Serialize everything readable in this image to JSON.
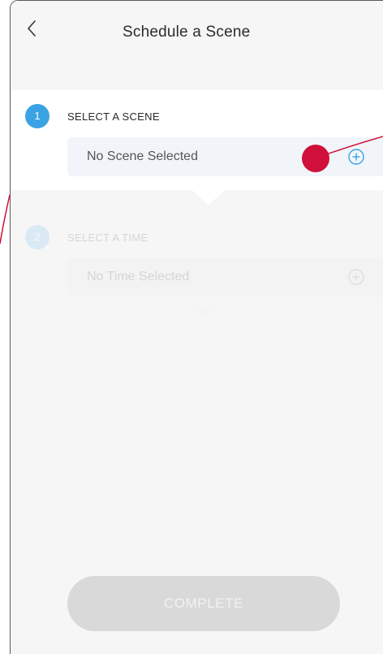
{
  "header": {
    "title": "Schedule a Scene",
    "back_icon": "chevron-left-icon"
  },
  "step1": {
    "number": "1",
    "label": "SELECT A SCENE",
    "selector_text": "No Scene Selected",
    "add_icon": "plus-circle-icon",
    "active": true
  },
  "step2": {
    "number": "2",
    "label": "SELECT A TIME",
    "selector_text": "No Time Selected",
    "add_icon": "plus-circle-icon",
    "active": false
  },
  "footer": {
    "complete_label": "COMPLETE",
    "enabled": false
  },
  "colors": {
    "accent": "#3aa3e3",
    "annotation": "#d0103a",
    "disabled_button": "#d9d9d9",
    "selector_bg": "#f1f5f9"
  }
}
